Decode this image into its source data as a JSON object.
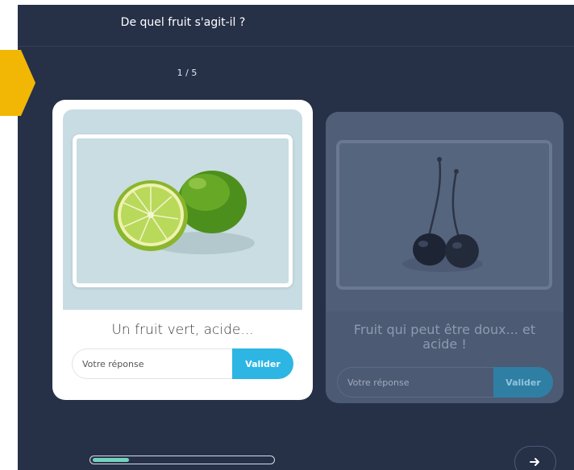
{
  "header": {
    "title": "De quel fruit s'agit-il ?"
  },
  "progress": {
    "counter": "1 / 5",
    "fraction": 0.2
  },
  "cards": [
    {
      "state": "active",
      "image_subject": "limes",
      "clue": "Un fruit vert, acide...",
      "input": {
        "placeholder": "Votre réponse",
        "value": ""
      },
      "validate_label": "Valider"
    },
    {
      "state": "inactive",
      "image_subject": "cherries",
      "clue": "Fruit qui peut être doux... et acide !",
      "input": {
        "placeholder": "Votre réponse",
        "value": ""
      },
      "validate_label": "Valider"
    }
  ],
  "navigation": {
    "next_icon": "arrow-right-icon"
  },
  "colors": {
    "background": "#263148",
    "accent": "#2db6e3",
    "marker": "#f2b705",
    "progress": "#74d3c0"
  }
}
